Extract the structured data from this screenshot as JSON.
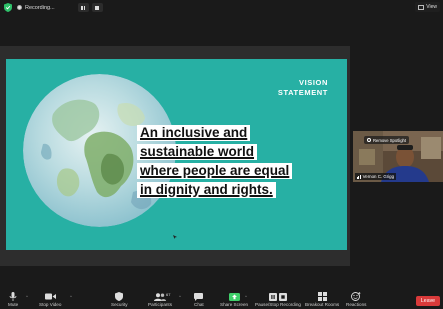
{
  "topbar": {
    "recording_label": "Recording...",
    "view_label": "View"
  },
  "slide": {
    "heading_line1": "VISION",
    "heading_line2": "STATEMENT",
    "statement_lines": [
      "An inclusive and",
      "sustainable world",
      "where people are equal",
      "in dignity and rights."
    ],
    "background_color": "#27b0a4"
  },
  "participant": {
    "spotlight_label": "Remove Spotlight",
    "name": "Vernon C. Grigg"
  },
  "toolbar": {
    "mute": "Mute",
    "stop_video": "Stop Video",
    "security": "Security",
    "participants": "Participants",
    "participants_count": "67",
    "chat": "Chat",
    "share_screen": "Share Screen",
    "pause_recording": "Pause/Stop Recording",
    "breakout_rooms": "Breakout Rooms",
    "reactions": "Reactions",
    "leave": "Leave"
  },
  "colors": {
    "leave": "#d93a3a",
    "share_active": "#3fd06a",
    "shield": "#2ec16a"
  }
}
